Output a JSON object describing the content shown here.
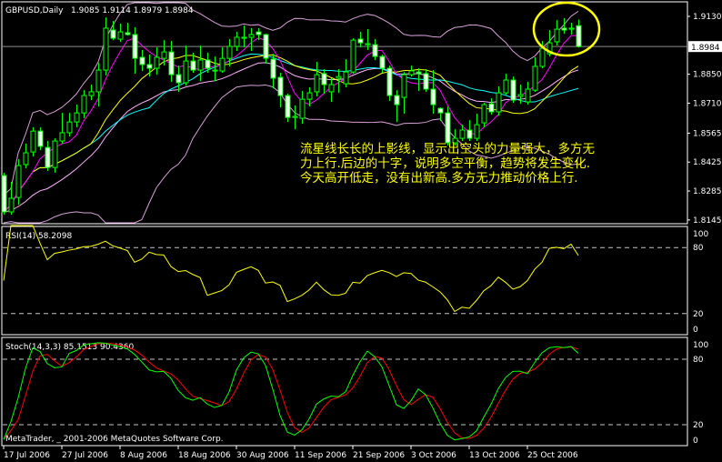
{
  "header": {
    "symbol_timeframe": "GBPUSD,Daily",
    "ohlc_text": "1.9085 1.9114 1.8979 1.8984"
  },
  "colors": {
    "background": "#000000",
    "frame": "#ffffff",
    "bull": "#00ff00",
    "bear_fill": "#ffffff",
    "ma_fast": "#ff00ff",
    "ma_mid": "#ffff00",
    "ma_slow": "#00ffff",
    "ma_slow2": "#ffb0ff",
    "bands": "#d8a0d8",
    "rsi": "#ffff00",
    "stoch_main": "#00ff00",
    "stoch_signal": "#ff0000",
    "annotation": "#ffff00"
  },
  "annotation": {
    "lines": [
      "流星线长长的上影线，显示出空头的力量强大，多方无",
      "力上行.后边的十字，说明多空平衡，趋势将发生变化.",
      "今天高开低走，没有出新高.多方无力推动价格上行."
    ],
    "highlight": "ellipse around last candles"
  },
  "rsi": {
    "label": "RSI(14) 58.2098",
    "levels": [
      "100",
      "80",
      "20",
      "0"
    ]
  },
  "stoch": {
    "label": "Stoch(14,3,3) 85.1513 90.4360",
    "levels": [
      "100",
      "80",
      "20",
      "0"
    ]
  },
  "copyright": "MetaTrader, _ 2001-2006 MetaQuotes Software Corp.",
  "chart_data": {
    "type": "candlestick",
    "symbol": "GBPUSD",
    "timeframe": "Daily",
    "price_ticks": [
      "1.9130",
      "1.8850",
      "1.8710",
      "1.8565",
      "1.8425",
      "1.8285",
      "1.8145"
    ],
    "current_price": "1.8984",
    "ylim": [
      1.813,
      1.916
    ],
    "date_ticks": [
      {
        "bar": 0,
        "label": "17 Jul 2006"
      },
      {
        "bar": 8,
        "label": "27 Jul 2006"
      },
      {
        "bar": 16,
        "label": "8 Aug 2006"
      },
      {
        "bar": 24,
        "label": "18 Aug 2006"
      },
      {
        "bar": 32,
        "label": "30 Aug 2006"
      },
      {
        "bar": 40,
        "label": "11 Sep 2006"
      },
      {
        "bar": 48,
        "label": "21 Sep 2006"
      },
      {
        "bar": 56,
        "label": "3 Oct 2006"
      },
      {
        "bar": 64,
        "label": "13 Oct 2006"
      },
      {
        "bar": 72,
        "label": "25 Oct 2006"
      }
    ],
    "ohlc": [
      [
        1.836,
        1.8373,
        1.8171,
        1.8184
      ],
      [
        1.8184,
        1.8329,
        1.8171,
        1.825
      ],
      [
        1.8254,
        1.8439,
        1.8219,
        1.8408
      ],
      [
        1.8413,
        1.8514,
        1.8395,
        1.847
      ],
      [
        1.8474,
        1.8593,
        1.8452,
        1.8575
      ],
      [
        1.8575,
        1.8593,
        1.8483,
        1.8501
      ],
      [
        1.8496,
        1.8527,
        1.8382,
        1.8399
      ],
      [
        1.8399,
        1.854,
        1.8373,
        1.8527
      ],
      [
        1.8527,
        1.8663,
        1.8514,
        1.8567
      ],
      [
        1.8567,
        1.8663,
        1.8549,
        1.8619
      ],
      [
        1.8619,
        1.8703,
        1.8593,
        1.8663
      ],
      [
        1.8663,
        1.8773,
        1.8637,
        1.8747
      ],
      [
        1.8747,
        1.88,
        1.8725,
        1.8765
      ],
      [
        1.8765,
        1.8905,
        1.8694,
        1.887
      ],
      [
        1.887,
        1.9125,
        1.8844,
        1.9073
      ],
      [
        1.9064,
        1.9108,
        1.9015,
        1.9024
      ],
      [
        1.902,
        1.9095,
        1.9007,
        1.9055
      ],
      [
        1.9051,
        1.9099,
        1.9037,
        1.9042
      ],
      [
        1.9042,
        1.9077,
        1.8853,
        1.8927
      ],
      [
        1.8932,
        1.8967,
        1.8866,
        1.8897
      ],
      [
        1.8897,
        1.8945,
        1.8839,
        1.8879
      ],
      [
        1.8879,
        1.898,
        1.8848,
        1.8932
      ],
      [
        1.8927,
        1.9015,
        1.8892,
        1.8958
      ],
      [
        1.8958,
        1.9011,
        1.8813,
        1.8848
      ],
      [
        1.8848,
        1.8892,
        1.8765,
        1.8809
      ],
      [
        1.8809,
        1.8989,
        1.8795,
        1.8914
      ],
      [
        1.8914,
        1.8954,
        1.8857,
        1.887
      ],
      [
        1.887,
        1.8989,
        1.8817,
        1.8919
      ],
      [
        1.8919,
        1.8954,
        1.8857,
        1.8879
      ],
      [
        1.8866,
        1.8936,
        1.8817,
        1.887
      ],
      [
        1.8866,
        1.898,
        1.8857,
        1.8927
      ],
      [
        1.8927,
        1.902,
        1.8888,
        1.8985
      ],
      [
        1.8985,
        1.9055,
        1.8963,
        1.9029
      ],
      [
        1.9024,
        1.9086,
        1.898,
        1.9029
      ],
      [
        1.9029,
        1.9073,
        1.8963,
        1.9042
      ],
      [
        1.9055,
        1.9073,
        1.9015,
        1.9042
      ],
      [
        1.9042,
        1.9046,
        1.8901,
        1.8927
      ],
      [
        1.8923,
        1.8949,
        1.8782,
        1.8831
      ],
      [
        1.8835,
        1.8857,
        1.869,
        1.8747
      ],
      [
        1.8747,
        1.8756,
        1.8619,
        1.8641
      ],
      [
        1.8641,
        1.8699,
        1.8584,
        1.8646
      ],
      [
        1.8637,
        1.8769,
        1.8611,
        1.8729
      ],
      [
        1.8729,
        1.8787,
        1.8694,
        1.876
      ],
      [
        1.8765,
        1.891,
        1.8743,
        1.8848
      ],
      [
        1.8853,
        1.8875,
        1.8756,
        1.88
      ],
      [
        1.8765,
        1.8831,
        1.8716,
        1.88
      ],
      [
        1.8831,
        1.8875,
        1.876,
        1.8839
      ],
      [
        1.8804,
        1.8923,
        1.8787,
        1.8861
      ],
      [
        1.8861,
        1.9024,
        1.8853,
        1.9015
      ],
      [
        1.902,
        1.9055,
        1.898,
        1.9002
      ],
      [
        1.8993,
        1.9068,
        1.8967,
        1.8998
      ],
      [
        1.8993,
        1.902,
        1.8919,
        1.8936
      ],
      [
        1.8936,
        1.8945,
        1.8857,
        1.8879
      ],
      [
        1.8879,
        1.8892,
        1.8721,
        1.8747
      ],
      [
        1.8747,
        1.8773,
        1.8619,
        1.8703
      ],
      [
        1.8738,
        1.8861,
        1.8659,
        1.8848
      ],
      [
        1.8848,
        1.8892,
        1.8839,
        1.8866
      ],
      [
        1.8861,
        1.8879,
        1.8769,
        1.8853
      ],
      [
        1.8853,
        1.8875,
        1.8765,
        1.8778
      ],
      [
        1.8778,
        1.887,
        1.8659,
        1.8703
      ],
      [
        1.8685,
        1.869,
        1.8624,
        1.8663
      ],
      [
        1.8663,
        1.8694,
        1.8505,
        1.8518
      ],
      [
        1.8518,
        1.8584,
        1.8505,
        1.854
      ],
      [
        1.854,
        1.8606,
        1.8527,
        1.858
      ],
      [
        1.858,
        1.8628,
        1.8527,
        1.854
      ],
      [
        1.854,
        1.8659,
        1.8527,
        1.8606
      ],
      [
        1.8615,
        1.8712,
        1.8593,
        1.8703
      ],
      [
        1.8707,
        1.8734,
        1.8655,
        1.8668
      ],
      [
        1.8668,
        1.8791,
        1.865,
        1.876
      ],
      [
        1.876,
        1.8853,
        1.8751,
        1.8822
      ],
      [
        1.8822,
        1.8839,
        1.8712,
        1.8725
      ],
      [
        1.8743,
        1.88,
        1.8707,
        1.8751
      ],
      [
        1.8716,
        1.8813,
        1.8703,
        1.8778
      ],
      [
        1.8773,
        1.8932,
        1.8765,
        1.8888
      ],
      [
        1.8888,
        1.9011,
        1.8879,
        1.8976
      ],
      [
        1.8949,
        1.9064,
        1.8936,
        1.9002
      ],
      [
        1.9007,
        1.9112,
        1.8989,
        1.9068
      ],
      [
        1.9073,
        1.9121,
        1.9046,
        1.9064
      ],
      [
        1.9068,
        1.9099,
        1.9042,
        1.9073
      ],
      [
        1.9085,
        1.9114,
        1.8979,
        1.8984
      ]
    ],
    "indicators": {
      "rsi_period": 14,
      "rsi_last": 58.2098,
      "stoch_params": [
        14,
        3,
        3
      ],
      "stoch_main_last": 85.1513,
      "stoch_signal_last": 90.436,
      "rsi_levels": [
        20,
        80
      ],
      "stoch_levels": [
        20,
        80
      ]
    }
  }
}
